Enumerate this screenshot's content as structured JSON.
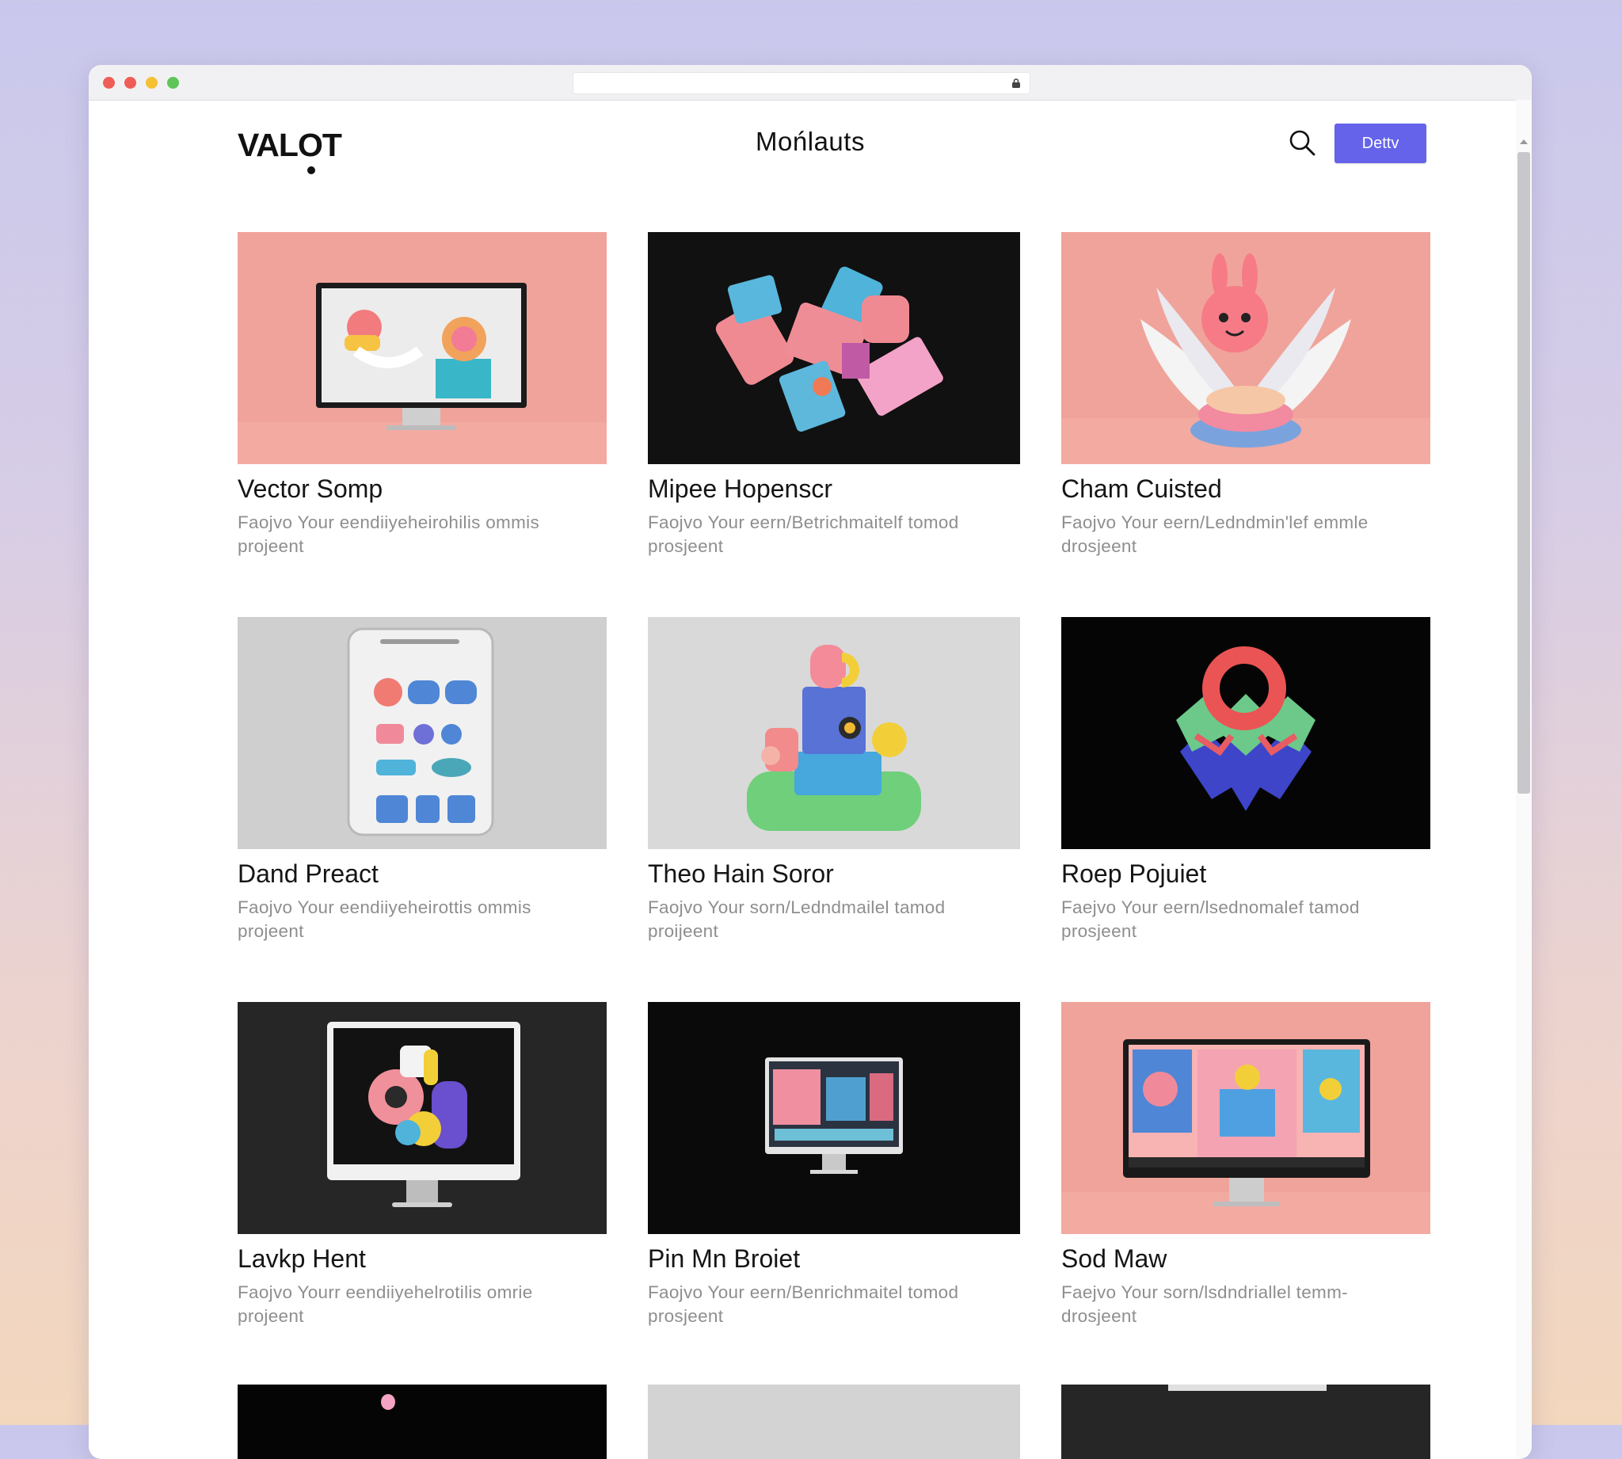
{
  "browser": {
    "traffic_lights": [
      "#ee5e57",
      "#ee5e57",
      "#f6c033",
      "#5fc557"
    ],
    "address": ""
  },
  "header": {
    "logo": "VALOT",
    "title": "Mońlauts",
    "action_label": "Dettv",
    "accent": "#6463ea"
  },
  "projects": [
    {
      "title": "Vector Somp",
      "description": "Faojvo Your eendiiyeheirohilis ommis projeent",
      "bg": "#f0a39a"
    },
    {
      "title": "Mipee Hopenscr",
      "description": "Faojvo Your eern/Betrichmaitelf tomod prosjeent",
      "bg": "#111111"
    },
    {
      "title": "Cham Cuisted",
      "description": "Faojvo Your eern/Ledndmin'lef emmle drosjeent",
      "bg": "#f0a39a"
    },
    {
      "title": "Dand Preact",
      "description": "Faojvo Your eendiiyeheirottis ommis projeent",
      "bg": "#cfcfcf"
    },
    {
      "title": "Theo Hain Soror",
      "description": "Faojvo Your sorn/Ledndmailel tamod proijeent",
      "bg": "#d9d9d9"
    },
    {
      "title": "Roep Pojuiet",
      "description": "Faejvo Your eern/lsednomalef tamod prosjeent",
      "bg": "#050505"
    },
    {
      "title": "Lavkp Hent",
      "description": "Faojvo Yourr eendiiyehelrotilis omrie projeent",
      "bg": "#262626"
    },
    {
      "title": "Pin Mn Broiet",
      "description": "Faojvo Your eern/Benrichmaitel tomod prosjeent",
      "bg": "#0a0a0a"
    },
    {
      "title": "Sod Maw",
      "description": "Faejvo Your sorn/lsdndriallel temm- drosjeent",
      "bg": "#f0a39a"
    }
  ]
}
